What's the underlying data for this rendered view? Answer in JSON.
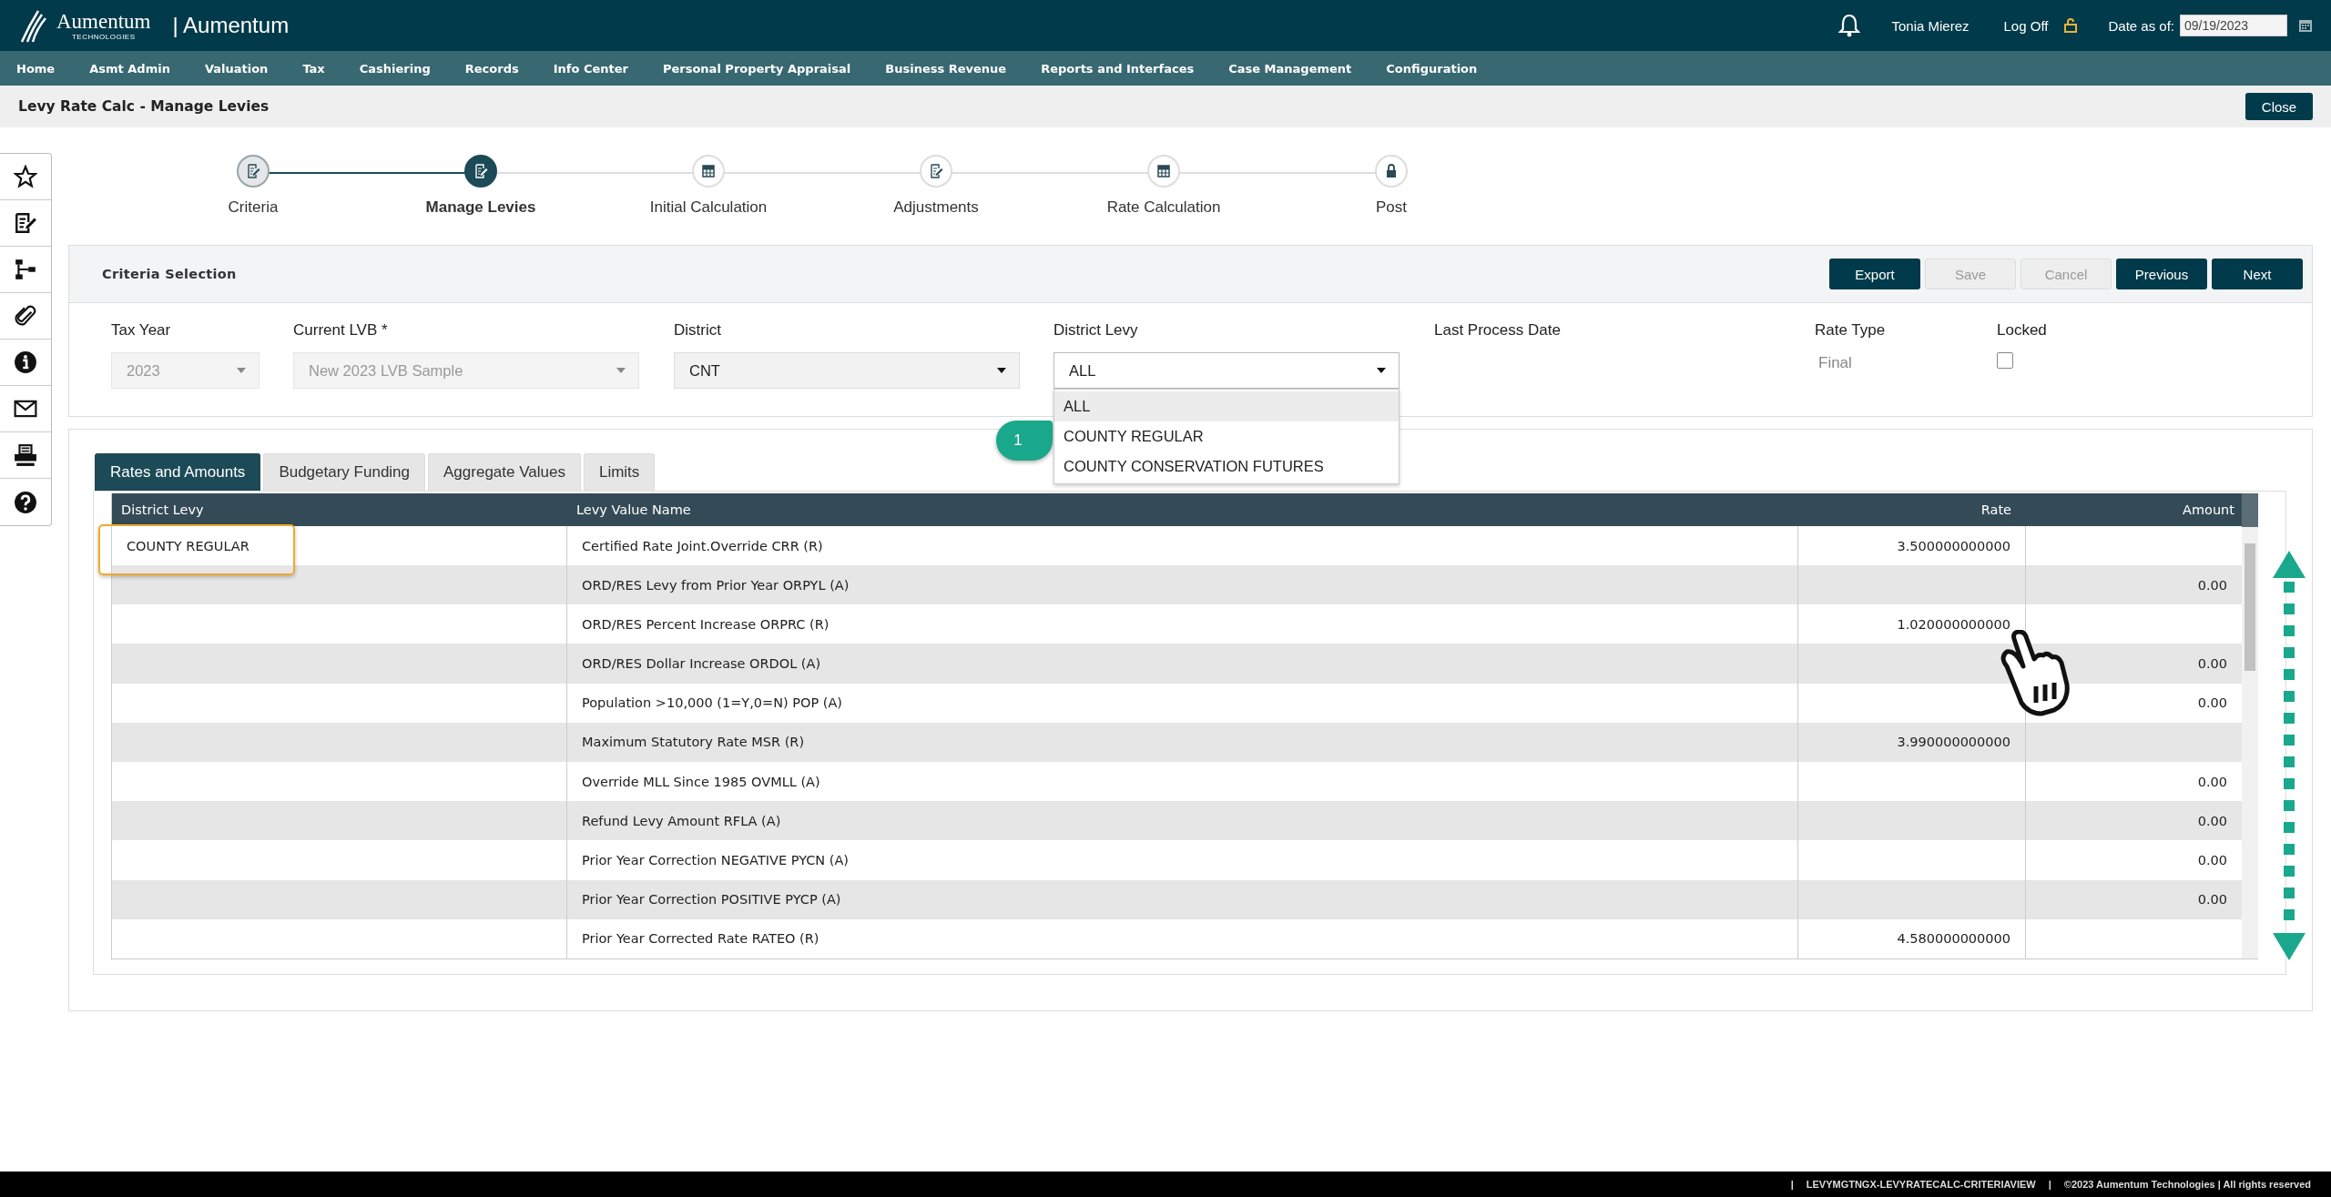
{
  "header": {
    "logo_text": "Aumentum",
    "logo_subtext": "TECHNOLOGIES",
    "app_name": "| Aumentum",
    "user": "Tonia Mierez",
    "logoff": "Log Off",
    "date_label": "Date as of:",
    "date_value": "09/19/2023"
  },
  "nav": [
    "Home",
    "Asmt Admin",
    "Valuation",
    "Tax",
    "Cashiering",
    "Records",
    "Info Center",
    "Personal Property Appraisal",
    "Business Revenue",
    "Reports and Interfaces",
    "Case Management",
    "Configuration"
  ],
  "page": {
    "title": "Levy Rate Calc - Manage Levies",
    "close": "Close"
  },
  "steps": [
    {
      "label": "Criteria",
      "selected": false
    },
    {
      "label": "Manage Levies",
      "selected": true
    },
    {
      "label": "Initial Calculation",
      "selected": false
    },
    {
      "label": "Adjustments",
      "selected": false
    },
    {
      "label": "Rate Calculation",
      "selected": false
    },
    {
      "label": "Post",
      "selected": false
    }
  ],
  "criteria": {
    "title": "Criteria Selection",
    "buttons": [
      {
        "label": "Export",
        "disabled": false
      },
      {
        "label": "Save",
        "disabled": true
      },
      {
        "label": "Cancel",
        "disabled": true
      },
      {
        "label": "Previous",
        "disabled": false
      },
      {
        "label": "Next",
        "disabled": false
      }
    ],
    "fields": [
      {
        "kind": "select",
        "label": "Tax Year",
        "value": "2023",
        "disabled": true
      },
      {
        "kind": "select",
        "label": "Current LVB *",
        "value": "New 2023 LVB Sample",
        "disabled": true
      },
      {
        "kind": "select",
        "label": "District",
        "value": "CNT",
        "disabled": false
      },
      {
        "kind": "select",
        "label": "District Levy",
        "value": "ALL",
        "disabled": false,
        "expanded": true,
        "options": [
          {
            "label": "ALL",
            "selected": true
          },
          {
            "label": "COUNTY REGULAR",
            "selected": false
          },
          {
            "label": "COUNTY CONSERVATION FUTURES",
            "selected": false
          }
        ]
      },
      {
        "kind": "text",
        "label": "Last Process Date"
      },
      {
        "kind": "text",
        "label": "Rate Type",
        "value": "Final"
      },
      {
        "kind": "checkbox",
        "label": "Locked",
        "checked": false
      }
    ]
  },
  "tabs": [
    {
      "label": "Rates and Amounts",
      "selected": true
    },
    {
      "label": "Budgetary Funding",
      "selected": false
    },
    {
      "label": "Aggregate Values",
      "selected": false
    },
    {
      "label": "Limits",
      "selected": false
    }
  ],
  "table": {
    "columns": [
      "District Levy",
      "Levy Value Name",
      "Rate",
      "Amount"
    ],
    "rows": [
      [
        "COUNTY REGULAR",
        "Certified Rate Joint.Override CRR (R)",
        "3.500000000000",
        ""
      ],
      [
        "",
        "ORD/RES Levy from Prior Year ORPYL (A)",
        "",
        "0.00"
      ],
      [
        "",
        "ORD/RES Percent Increase ORPRC (R)",
        "1.020000000000",
        ""
      ],
      [
        "",
        "ORD/RES Dollar Increase ORDOL (A)",
        "",
        "0.00"
      ],
      [
        "",
        "Population >10,000 (1=Y,0=N) POP (A)",
        "",
        "0.00"
      ],
      [
        "",
        "Maximum Statutory Rate MSR (R)",
        "3.990000000000",
        ""
      ],
      [
        "",
        "Override MLL Since 1985 OVMLL (A)",
        "",
        "0.00"
      ],
      [
        "",
        "Refund Levy Amount RFLA (A)",
        "",
        "0.00"
      ],
      [
        "",
        "Prior Year Correction NEGATIVE PYCN (A)",
        "",
        "0.00"
      ],
      [
        "",
        "Prior Year Correction POSITIVE PYCP (A)",
        "",
        "0.00"
      ],
      [
        "",
        "Prior Year Corrected Rate RATEO (R)",
        "4.580000000000",
        ""
      ]
    ]
  },
  "callout": {
    "number": "1"
  },
  "footer": [
    "|",
    "LEVYMGTNGX-LEVYRATECALC-CRITERIAVIEW",
    "|",
    "©2023 Aumentum Technologies | All rights reserved"
  ]
}
